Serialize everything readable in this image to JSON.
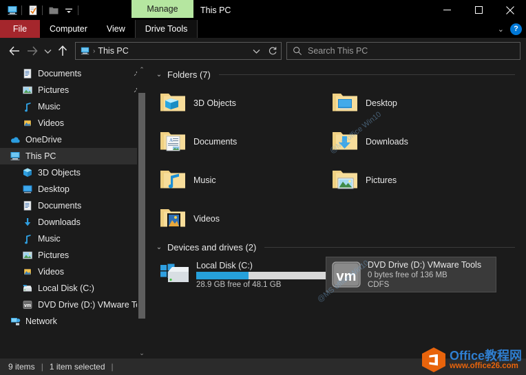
{
  "window": {
    "title": "This PC",
    "contextual_tab": "Manage",
    "controls": {
      "minimize": "—",
      "maximize": "□",
      "close": "✕"
    },
    "quick_access": [
      {
        "name": "this-pc-icon",
        "glyph": "pc"
      },
      {
        "name": "properties-icon",
        "glyph": "doc-check"
      },
      {
        "name": "new-folder-icon",
        "glyph": "folder"
      },
      {
        "name": "customize-qat-icon",
        "glyph": "chevron-down"
      }
    ]
  },
  "ribbon": {
    "tabs": [
      {
        "label": "File",
        "style": "file"
      },
      {
        "label": "Computer",
        "style": "normal"
      },
      {
        "label": "View",
        "style": "normal"
      },
      {
        "label": "Drive Tools",
        "style": "contextual"
      }
    ],
    "collapse_glyph": "⌄",
    "help_glyph": "?"
  },
  "address": {
    "back_glyph": "←",
    "forward_glyph": "→",
    "recent_glyph": "⌄",
    "up_glyph": "↑",
    "crumb_icon": "pc",
    "crumb_sep": "›",
    "crumb_text": "This PC",
    "dropdown_glyph": "⌄",
    "refresh_glyph": "↻"
  },
  "search": {
    "icon": "search-icon",
    "placeholder": "Search This PC"
  },
  "sidebar": {
    "items": [
      {
        "label": "Documents",
        "icon": "documents",
        "indent": 1,
        "pinned": true,
        "selected": false
      },
      {
        "label": "Pictures",
        "icon": "pictures",
        "indent": 1,
        "pinned": true,
        "selected": false
      },
      {
        "label": "Music",
        "icon": "music",
        "indent": 1,
        "pinned": false,
        "selected": false
      },
      {
        "label": "Videos",
        "icon": "videos",
        "indent": 1,
        "pinned": false,
        "selected": false
      },
      {
        "label": "OneDrive",
        "icon": "onedrive",
        "indent": 0,
        "pinned": false,
        "selected": false
      },
      {
        "label": "This PC",
        "icon": "pc",
        "indent": 0,
        "pinned": false,
        "selected": true
      },
      {
        "label": "3D Objects",
        "icon": "3dobjects",
        "indent": 1,
        "pinned": false,
        "selected": false
      },
      {
        "label": "Desktop",
        "icon": "desktop",
        "indent": 1,
        "pinned": false,
        "selected": false
      },
      {
        "label": "Documents",
        "icon": "documents",
        "indent": 1,
        "pinned": false,
        "selected": false
      },
      {
        "label": "Downloads",
        "icon": "downloads",
        "indent": 1,
        "pinned": false,
        "selected": false
      },
      {
        "label": "Music",
        "icon": "music",
        "indent": 1,
        "pinned": false,
        "selected": false
      },
      {
        "label": "Pictures",
        "icon": "pictures",
        "indent": 1,
        "pinned": false,
        "selected": false
      },
      {
        "label": "Videos",
        "icon": "videos",
        "indent": 1,
        "pinned": false,
        "selected": false
      },
      {
        "label": "Local Disk (C:)",
        "icon": "harddrive",
        "indent": 1,
        "pinned": false,
        "selected": false
      },
      {
        "label": "DVD Drive (D:) VMware Tools",
        "icon": "vmdisc",
        "indent": 1,
        "pinned": false,
        "selected": false
      },
      {
        "label": "Network",
        "icon": "network",
        "indent": 0,
        "pinned": false,
        "selected": false
      }
    ],
    "scroll": {
      "up_glyph": "⌃",
      "down_glyph": "⌄"
    }
  },
  "main": {
    "folders_group": {
      "chevron": "⌄",
      "title": "Folders (7)",
      "items": [
        {
          "name": "3D Objects",
          "icon": "folder-3dobjects"
        },
        {
          "name": "Desktop",
          "icon": "folder-desktop"
        },
        {
          "name": "Documents",
          "icon": "folder-documents"
        },
        {
          "name": "Downloads",
          "icon": "folder-downloads"
        },
        {
          "name": "Music",
          "icon": "folder-music"
        },
        {
          "name": "Pictures",
          "icon": "folder-pictures"
        },
        {
          "name": "Videos",
          "icon": "folder-videos"
        }
      ]
    },
    "drives_group": {
      "chevron": "⌄",
      "title": "Devices and drives (2)",
      "items": [
        {
          "name": "Local Disk (C:)",
          "icon": "harddrive-windows",
          "capacity_text": "28.9 GB free of 48.1 GB",
          "used_percent": 40,
          "filesystem": "",
          "selected": false
        },
        {
          "name": "DVD Drive (D:) VMware Tools",
          "icon": "vmware-disc",
          "capacity_text": "0 bytes free of 136 MB",
          "used_percent": 100,
          "filesystem": "CDFS",
          "selected": true
        }
      ]
    }
  },
  "statusbar": {
    "item_count": "9 items",
    "selection": "1 item selected",
    "sep": "|"
  },
  "watermark": {
    "diagonal_text": "@MS office Win10",
    "logo_line1": "Office教程网",
    "logo_line2": "www.office26.com"
  },
  "colors": {
    "file_tab": "#a4262c",
    "contextual_tab": "#b5e6a0",
    "accent": "#0078d7",
    "progress": "#26a0da",
    "selection": "#3a3a3a",
    "window_bg": "#1b1b1b"
  }
}
